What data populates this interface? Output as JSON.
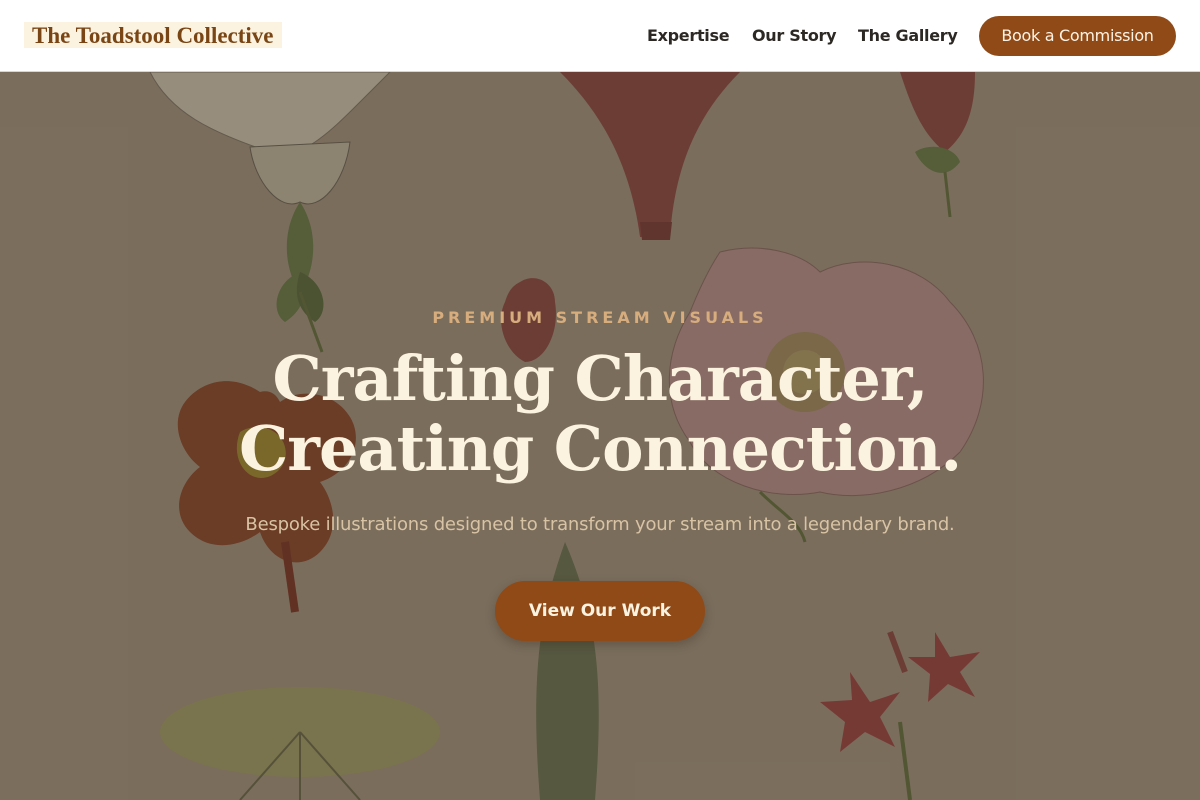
{
  "header": {
    "brand": "The Toadstool Collective",
    "nav": [
      "Expertise",
      "Our Story",
      "The Gallery"
    ],
    "cta": "Book a Commission"
  },
  "hero": {
    "eyebrow": "PREMIUM STREAM VISUALS",
    "headline_line1": "Crafting Character,",
    "headline_line2": "Creating Connection.",
    "subheadline": "Bespoke illustrations designed to transform your stream into a legendary brand.",
    "cta": "View Our Work"
  },
  "colors": {
    "accent": "#8f4a18",
    "brand_text": "#7a4515",
    "headline": "#fbf3df",
    "eyebrow": "#d7ad7e",
    "hero_background": "#7d705f"
  }
}
